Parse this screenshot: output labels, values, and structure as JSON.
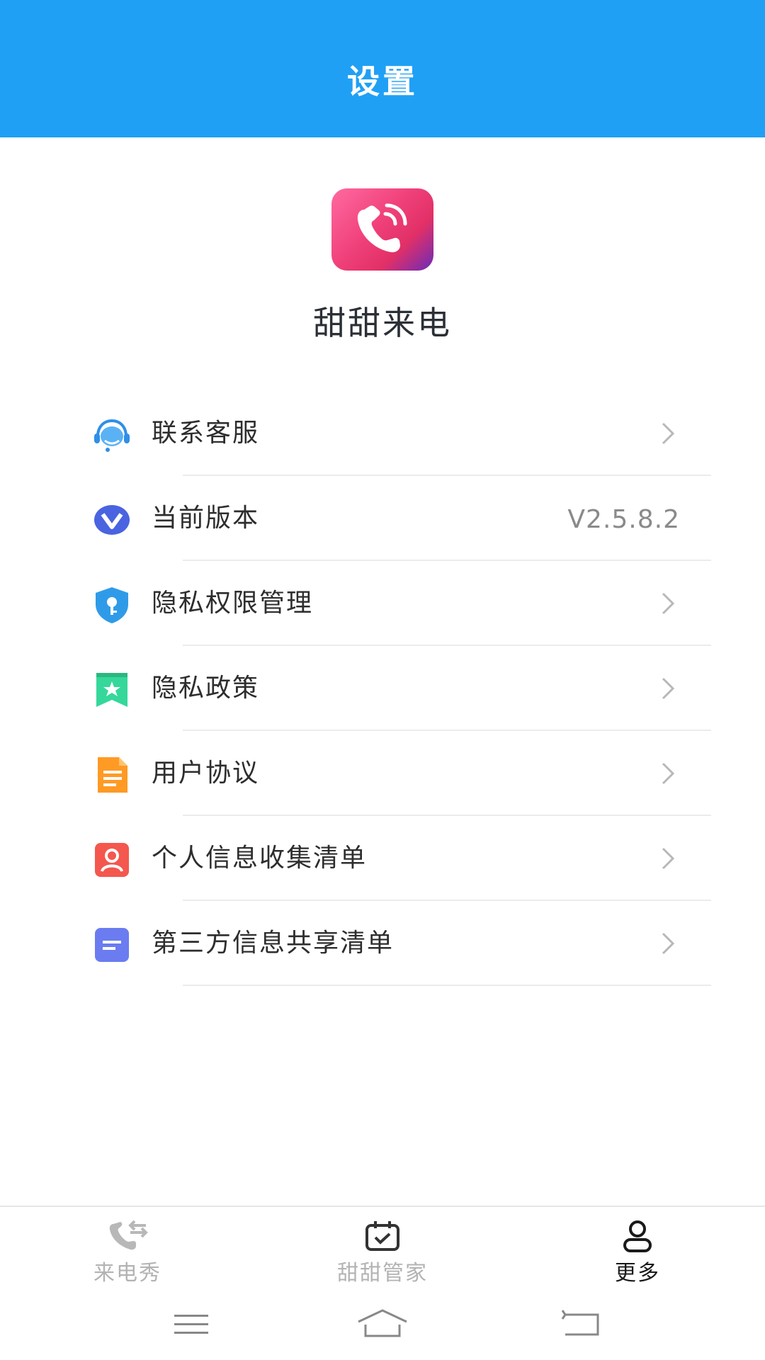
{
  "header": {
    "title": "设置"
  },
  "app": {
    "name": "甜甜来电",
    "logo_icon": "phone-ringing-icon"
  },
  "menu": [
    {
      "label": "联系客服",
      "icon": "customer-service-icon",
      "value": ""
    },
    {
      "label": "当前版本",
      "icon": "version-icon",
      "value": "V2.5.8.2"
    },
    {
      "label": "隐私权限管理",
      "icon": "shield-key-icon",
      "value": ""
    },
    {
      "label": "隐私政策",
      "icon": "bookmark-star-icon",
      "value": ""
    },
    {
      "label": "用户协议",
      "icon": "document-icon",
      "value": ""
    },
    {
      "label": "个人信息收集清单",
      "icon": "person-card-icon",
      "value": ""
    },
    {
      "label": "第三方信息共享清单",
      "icon": "share-list-icon",
      "value": ""
    }
  ],
  "tabbar": {
    "tabs": [
      {
        "label": "来电秀",
        "icon": "phone-transfer-icon",
        "active": false
      },
      {
        "label": "甜甜管家",
        "icon": "calendar-check-icon",
        "active": false
      },
      {
        "label": "更多",
        "icon": "user-icon",
        "active": true
      }
    ]
  },
  "colors": {
    "header": "#20a0f5",
    "tab_active": "#1a1a1a",
    "tab_inactive": "#b3b3b3"
  }
}
